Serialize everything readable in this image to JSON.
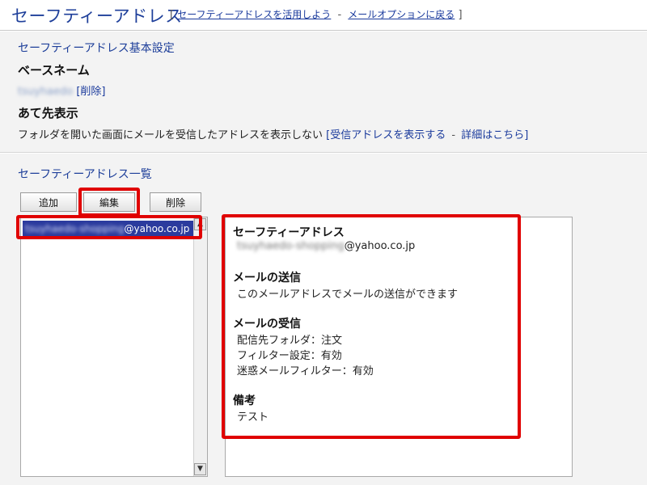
{
  "header": {
    "title": "セーフティーアドレス",
    "bracket_open": "[",
    "bracket_close": "]",
    "link_use": "セーフティーアドレスを活用しよう",
    "separator": "-",
    "link_back": "メールオプションに戻る"
  },
  "settings": {
    "section_title": "セーフティーアドレス基本設定",
    "basename_label": "ベースネーム",
    "basename_value": "tsuyhaedo",
    "delete_link": "[削除]",
    "destination_label": "あて先表示",
    "destination_text": "フォルダを開いた画面にメールを受信したアドレスを表示しない",
    "bracket_open": "[",
    "bracket_close": "]",
    "show_link": "受信アドレスを表示する",
    "separator": "-",
    "details_link": "詳細はこちら"
  },
  "list": {
    "section_title": "セーフティーアドレス一覧",
    "buttons": {
      "add": "追加",
      "edit": "編集",
      "delete": "削除"
    },
    "items": [
      {
        "prefix": "tsuyhaedo-shopping",
        "domain": "@yahoo.co.jp",
        "selected": true
      }
    ]
  },
  "detail": {
    "address_label": "セーフティーアドレス",
    "address_prefix": "tsuyhaedo-shopping",
    "address_domain": "@yahoo.co.jp",
    "send_label": "メールの送信",
    "send_value": "このメールアドレスでメールの送信ができます",
    "receive_label": "メールの受信",
    "receive_folder": "配信先フォルダ：注文",
    "receive_filter": "フィルター設定：有効",
    "receive_spam": "迷惑メールフィルター：有効",
    "note_label": "備考",
    "note_value": "テスト"
  },
  "icons": {
    "scroll_up": "scroll-up-arrow-icon",
    "scroll_down": "scroll-down-arrow-icon"
  },
  "colors": {
    "highlight_red": "#e00000",
    "link_blue": "#1a3a9c",
    "selection_blue": "#2b3b9e"
  }
}
